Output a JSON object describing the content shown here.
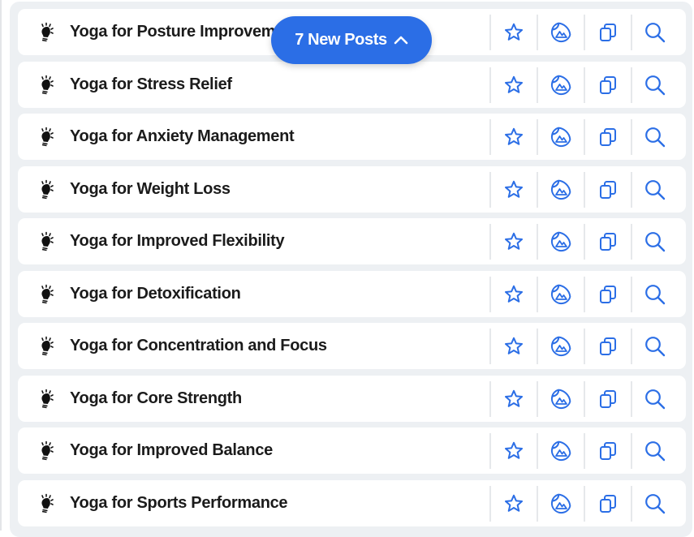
{
  "new_posts_button": {
    "label": "7 New Posts",
    "icon": "chevron-up-icon"
  },
  "colors": {
    "accent": "#2b6ee6",
    "icon_blue": "#2b6ee6",
    "row_bg": "#ffffff",
    "panel_bg": "#edf0f3"
  },
  "row_icon": "lightbulb-icon",
  "actions": [
    {
      "name": "favorite",
      "icon": "star-icon"
    },
    {
      "name": "generate-image",
      "icon": "image-sticker-icon"
    },
    {
      "name": "copy",
      "icon": "copy-icon"
    },
    {
      "name": "search",
      "icon": "search-icon"
    }
  ],
  "posts": [
    {
      "title": "Yoga for Posture Improvement"
    },
    {
      "title": "Yoga for Stress Relief"
    },
    {
      "title": "Yoga for Anxiety Management"
    },
    {
      "title": "Yoga for Weight Loss"
    },
    {
      "title": "Yoga for Improved Flexibility"
    },
    {
      "title": "Yoga for Detoxification"
    },
    {
      "title": "Yoga for Concentration and Focus"
    },
    {
      "title": "Yoga for Core Strength"
    },
    {
      "title": "Yoga for Improved Balance"
    },
    {
      "title": "Yoga for Sports Performance"
    }
  ]
}
